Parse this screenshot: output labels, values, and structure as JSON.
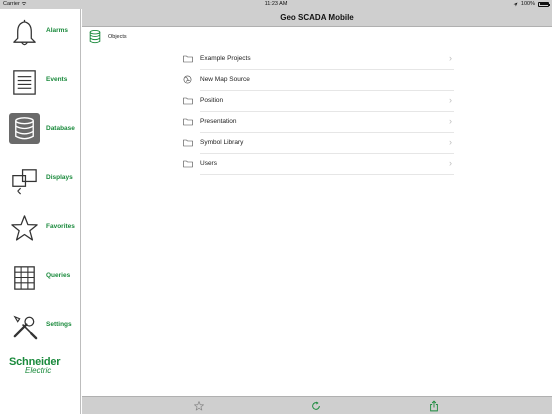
{
  "statusbar": {
    "carrier": "Carrier",
    "time": "11:23 AM",
    "battery": "100%"
  },
  "navbar": {
    "title": "Geo SCADA Mobile"
  },
  "sidebar": {
    "items": [
      {
        "label": "Alarms",
        "icon": "bell-icon"
      },
      {
        "label": "Events",
        "icon": "events-list-icon"
      },
      {
        "label": "Database",
        "icon": "database-icon",
        "active": true
      },
      {
        "label": "Displays",
        "icon": "displays-icon"
      },
      {
        "label": "Favorites",
        "icon": "star-icon"
      },
      {
        "label": "Queries",
        "icon": "grid-icon"
      },
      {
        "label": "Settings",
        "icon": "tools-icon"
      }
    ],
    "logo": {
      "line1": "Schneider",
      "line2": "Electric"
    }
  },
  "breadcrumb": {
    "label": "Objects",
    "icon": "database-icon"
  },
  "objects": [
    {
      "label": "Example Projects",
      "icon": "folder-icon"
    },
    {
      "label": "New Map Source",
      "icon": "map-source-icon"
    },
    {
      "label": "Position",
      "icon": "folder-icon"
    },
    {
      "label": "Presentation",
      "icon": "folder-icon"
    },
    {
      "label": "Symbol Library",
      "icon": "folder-icon"
    },
    {
      "label": "Users",
      "icon": "folder-icon"
    }
  ],
  "toolbar": {
    "buttons": [
      "star-icon",
      "refresh-icon",
      "share-icon"
    ]
  },
  "colors": {
    "accent": "#1a8a3c",
    "bar": "#cfcfcf",
    "active_tile": "#6a6a6a"
  }
}
